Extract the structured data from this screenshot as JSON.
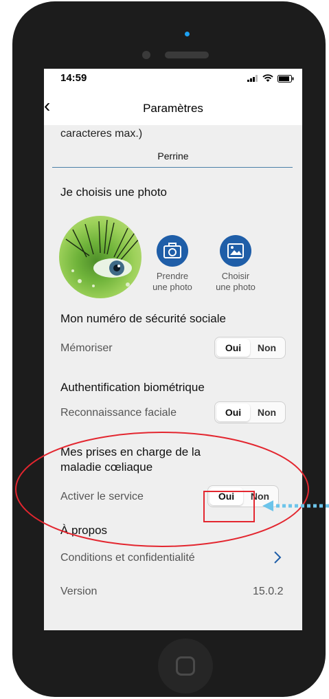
{
  "status": {
    "time": "14:59"
  },
  "nav": {
    "back_glyph": "‹",
    "title": "Paramètres"
  },
  "name_section": {
    "partial_label": "caracteres max.)",
    "value": "Perrine"
  },
  "photo": {
    "title": "Je choisis une photo",
    "take_label_1": "Prendre",
    "take_label_2": "une photo",
    "choose_label_1": "Choisir",
    "choose_label_2": "une photo"
  },
  "social": {
    "title": "Mon numéro de sécurité sociale",
    "row_label": "Mémoriser",
    "yes": "Oui",
    "no": "Non"
  },
  "biometric": {
    "title": "Authentification biométrique",
    "row_label": "Reconnaissance faciale",
    "yes": "Oui",
    "no": "Non"
  },
  "celiac": {
    "title_1": "Mes prises en charge de la",
    "title_2": "maladie cœliaque",
    "row_label": "Activer le service",
    "yes": "Oui",
    "no": "Non"
  },
  "about": {
    "title": "À propos",
    "conditions": "Conditions et confidentialité",
    "version_label": "Version",
    "version_value": "15.0.2"
  },
  "colors": {
    "accent": "#1f5ea8",
    "annotation_red": "#e3262f",
    "annotation_arrow": "#6cc4ea"
  }
}
